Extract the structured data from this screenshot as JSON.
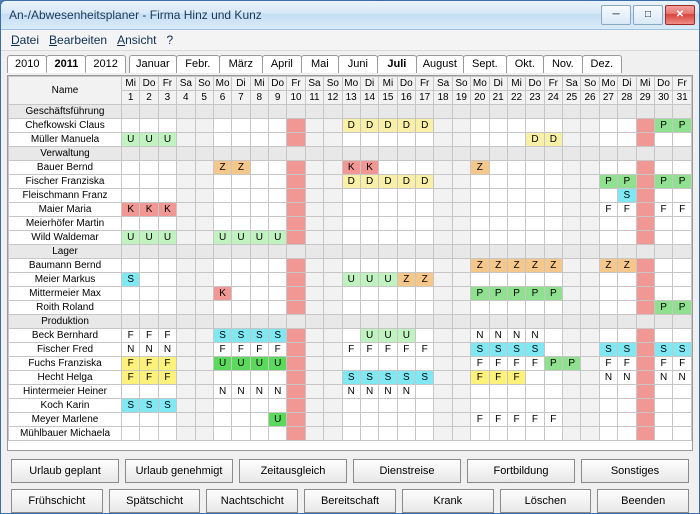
{
  "window": {
    "title": "An-/Abwesenheitsplaner - Firma Hinz und Kunz"
  },
  "menu": {
    "file": "Datei",
    "edit": "Bearbeiten",
    "view": "Ansicht",
    "help": "?"
  },
  "years": [
    "2010",
    "2011",
    "2012"
  ],
  "yearSel": 1,
  "months": [
    "Januar",
    "Febr.",
    "März",
    "April",
    "Mai",
    "Juni",
    "Juli",
    "August",
    "Sept.",
    "Okt.",
    "Nov.",
    "Dez."
  ],
  "monthSel": 6,
  "nameHeader": "Name",
  "dayCols": [
    {
      "wd": "Mi",
      "d": "1"
    },
    {
      "wd": "Do",
      "d": "2"
    },
    {
      "wd": "Fr",
      "d": "3"
    },
    {
      "wd": "Sa",
      "d": "4",
      "we": 1
    },
    {
      "wd": "So",
      "d": "5",
      "we": 1
    },
    {
      "wd": "Mo",
      "d": "6"
    },
    {
      "wd": "Di",
      "d": "7"
    },
    {
      "wd": "Mi",
      "d": "8"
    },
    {
      "wd": "Do",
      "d": "9"
    },
    {
      "wd": "Fr",
      "d": "10",
      "hol": 1
    },
    {
      "wd": "Sa",
      "d": "11",
      "we": 1
    },
    {
      "wd": "So",
      "d": "12",
      "we": 1
    },
    {
      "wd": "Mo",
      "d": "13"
    },
    {
      "wd": "Di",
      "d": "14"
    },
    {
      "wd": "Mi",
      "d": "15"
    },
    {
      "wd": "Do",
      "d": "16"
    },
    {
      "wd": "Fr",
      "d": "17"
    },
    {
      "wd": "Sa",
      "d": "18",
      "we": 1
    },
    {
      "wd": "So",
      "d": "19",
      "we": 1
    },
    {
      "wd": "Mo",
      "d": "20"
    },
    {
      "wd": "Di",
      "d": "21"
    },
    {
      "wd": "Mi",
      "d": "22"
    },
    {
      "wd": "Do",
      "d": "23"
    },
    {
      "wd": "Fr",
      "d": "24"
    },
    {
      "wd": "Sa",
      "d": "25",
      "we": 1
    },
    {
      "wd": "So",
      "d": "26",
      "we": 1
    },
    {
      "wd": "Mo",
      "d": "27"
    },
    {
      "wd": "Di",
      "d": "28"
    },
    {
      "wd": "Mi",
      "d": "29",
      "hol": 1
    },
    {
      "wd": "Do",
      "d": "30"
    },
    {
      "wd": "Fr",
      "d": "31"
    }
  ],
  "rows": [
    {
      "group": 1,
      "name": "Geschäftsführung"
    },
    {
      "name": "Chefkowski Claus",
      "cells": {
        "13": "D",
        "14": "D",
        "15": "D",
        "16": "D",
        "17": "D",
        "30": "P",
        "31": "P"
      }
    },
    {
      "name": "Müller Manuela",
      "cells": {
        "1": "U",
        "2": "U",
        "3": "U",
        "23": "D",
        "24": "D"
      }
    },
    {
      "group": 1,
      "name": "Verwaltung"
    },
    {
      "name": "Bauer Bernd",
      "cells": {
        "6": "Z",
        "7": "Z",
        "13": "K",
        "14": "K",
        "20": "Z"
      }
    },
    {
      "name": "Fischer Franziska",
      "cells": {
        "13": "D",
        "14": "D",
        "15": "D",
        "16": "D",
        "17": "D",
        "27": "P",
        "28": "P",
        "30": "P",
        "31": "P"
      }
    },
    {
      "name": "Fleischmann Franz",
      "cells": {
        "28": "S"
      }
    },
    {
      "name": "Maier Maria",
      "cells": {
        "1": "K",
        "2": "K",
        "3": "K",
        "27": "F",
        "28": "F",
        "30": "F",
        "31": "F"
      }
    },
    {
      "name": "Meierhöfer Martin"
    },
    {
      "name": "Wild Waldemar",
      "cells": {
        "1": "U",
        "2": "U",
        "3": "U",
        "6": "U",
        "7": "U",
        "8": "U",
        "9": "U"
      }
    },
    {
      "group": 1,
      "name": "Lager"
    },
    {
      "name": "Baumann Bernd",
      "cells": {
        "20": "Z",
        "21": "Z",
        "22": "Z",
        "23": "Z",
        "24": "Z",
        "27": "Z",
        "28": "Z"
      }
    },
    {
      "name": "Meier Markus",
      "cells": {
        "1": "S",
        "13": "U",
        "14": "U",
        "15": "U",
        "16": "Z",
        "17": "Z"
      }
    },
    {
      "name": "Mittermeier Max",
      "cells": {
        "6": "K",
        "20": "P",
        "21": "P",
        "22": "P",
        "23": "P",
        "24": "P"
      }
    },
    {
      "name": "Roith Roland",
      "cells": {
        "30": "P",
        "31": "P"
      }
    },
    {
      "group": 1,
      "name": "Produktion"
    },
    {
      "name": "Beck Bernhard",
      "cells": {
        "1": "F",
        "2": "F",
        "3": "F",
        "6": "S",
        "7": "S",
        "8": "S",
        "9": "S",
        "14": "U",
        "15": "U",
        "16": "U",
        "20": "N",
        "21": "N",
        "22": "N",
        "23": "N"
      }
    },
    {
      "name": "Fischer Fred",
      "cells": {
        "1": "N",
        "2": "N",
        "3": "N",
        "6": "F",
        "7": "F",
        "8": "F",
        "9": "F",
        "13": "F",
        "14": "F",
        "15": "F",
        "16": "F",
        "17": "F",
        "20": "S",
        "21": "S",
        "22": "S",
        "23": "S",
        "27": "S",
        "28": "S",
        "30": "S",
        "31": "S"
      }
    },
    {
      "name": "Fuchs Franziska",
      "cells": {
        "1": "Fo",
        "2": "Fo",
        "3": "Fo",
        "6": "Ug",
        "7": "Ug",
        "8": "Ug",
        "9": "Ug",
        "20": "F",
        "21": "F",
        "22": "F",
        "23": "F",
        "24": "P",
        "25": "P",
        "27": "F",
        "28": "F",
        "30": "F",
        "31": "F"
      }
    },
    {
      "name": "Hecht Helga",
      "cells": {
        "1": "Fo",
        "2": "Fo",
        "3": "Fo",
        "13": "S",
        "14": "S",
        "15": "S",
        "16": "S",
        "17": "S",
        "20": "Fo",
        "21": "Fo",
        "22": "Fo",
        "27": "N",
        "28": "N",
        "30": "N",
        "31": "N"
      }
    },
    {
      "name": "Hintermeier Heiner",
      "cells": {
        "6": "N",
        "7": "N",
        "8": "N",
        "9": "N",
        "13": "N",
        "14": "N",
        "15": "N",
        "16": "N"
      }
    },
    {
      "name": "Koch Karin",
      "cells": {
        "1": "S",
        "2": "S",
        "3": "S"
      }
    },
    {
      "name": "Meyer Marlene",
      "cells": {
        "9": "Ug",
        "20": "F",
        "21": "F",
        "22": "F",
        "23": "F",
        "24": "F"
      }
    },
    {
      "name": "Mühlbauer Michaela"
    }
  ],
  "legend1": [
    {
      "l": "Urlaub geplant",
      "c": "c-U"
    },
    {
      "l": "Urlaub genehmigt",
      "c": "c-Ug"
    },
    {
      "l": "Zeitausgleich",
      "c": "c-Z"
    },
    {
      "l": "Dienstreise",
      "c": "c-D"
    },
    {
      "l": "Fortbildung",
      "c": "c-Fo"
    },
    {
      "l": "Sonstiges",
      "c": "c-S"
    }
  ],
  "legend2": [
    {
      "l": "Frühschicht"
    },
    {
      "l": "Spätschicht"
    },
    {
      "l": "Nachtschicht"
    },
    {
      "l": "Bereitschaft"
    },
    {
      "l": "Krank",
      "c": "c-K"
    },
    {
      "l": "Löschen"
    },
    {
      "l": "Beenden"
    }
  ],
  "codeMap": {
    "U": "c-U",
    "Ug": "c-Ug",
    "Z": "c-Z",
    "D": "c-D",
    "F": "c-F",
    "Fo": "c-Fo",
    "S": "c-S",
    "K": "c-K",
    "P": "c-P",
    "N": "c-N"
  },
  "codeText": {
    "U": "U",
    "Ug": "U",
    "Z": "Z",
    "D": "D",
    "F": "F",
    "Fo": "F",
    "S": "S",
    "K": "K",
    "P": "P",
    "N": "N"
  }
}
